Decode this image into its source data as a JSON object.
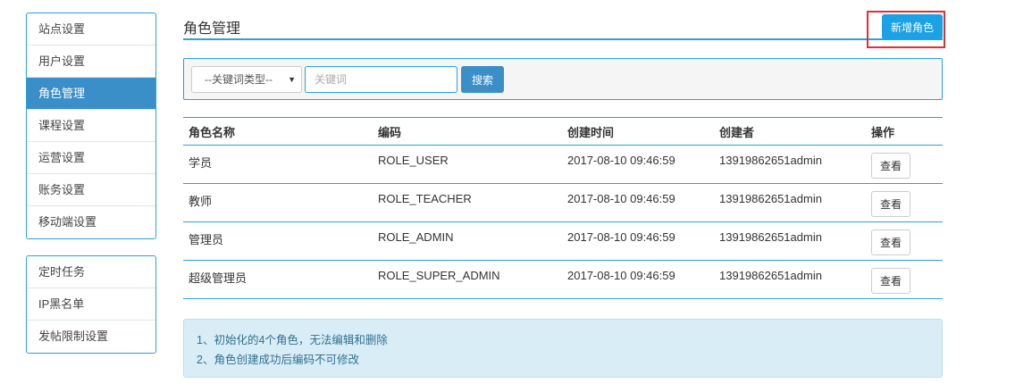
{
  "sidebar": {
    "group1": [
      {
        "label": "站点设置"
      },
      {
        "label": "用户设置"
      },
      {
        "label": "角色管理"
      },
      {
        "label": "课程设置"
      },
      {
        "label": "运营设置"
      },
      {
        "label": "账务设置"
      },
      {
        "label": "移动端设置"
      }
    ],
    "group2": [
      {
        "label": "定时任务"
      },
      {
        "label": "IP黑名单"
      },
      {
        "label": "发帖限制设置"
      }
    ]
  },
  "header": {
    "title": "角色管理",
    "add_button": "新增角色"
  },
  "search": {
    "keyword_type": "--关键词类型--",
    "keyword_placeholder": "关键词",
    "keyword_value": "",
    "search_button": "搜索"
  },
  "table": {
    "headers": [
      "角色名称",
      "编码",
      "创建时间",
      "创建者",
      "操作"
    ],
    "rows": [
      {
        "name": "学员",
        "code": "ROLE_USER",
        "created": "2017-08-10 09:46:59",
        "creator": "13919862651admin",
        "action": "查看"
      },
      {
        "name": "教师",
        "code": "ROLE_TEACHER",
        "created": "2017-08-10 09:46:59",
        "creator": "13919862651admin",
        "action": "查看"
      },
      {
        "name": "管理员",
        "code": "ROLE_ADMIN",
        "created": "2017-08-10 09:46:59",
        "creator": "13919862651admin",
        "action": "查看"
      },
      {
        "name": "超级管理员",
        "code": "ROLE_SUPER_ADMIN",
        "created": "2017-08-10 09:46:59",
        "creator": "13919862651admin",
        "action": "查看"
      }
    ]
  },
  "notes": [
    "1、初始化的4个角色，无法编辑和删除",
    "2、角色创建成功后编码不可修改"
  ],
  "colors": {
    "accent": "#2aa3d8",
    "active_nav": "#3a8fc8",
    "primary_button": "#1aa1e6",
    "highlight": "#e03131",
    "notes_bg": "#d9edf7"
  }
}
